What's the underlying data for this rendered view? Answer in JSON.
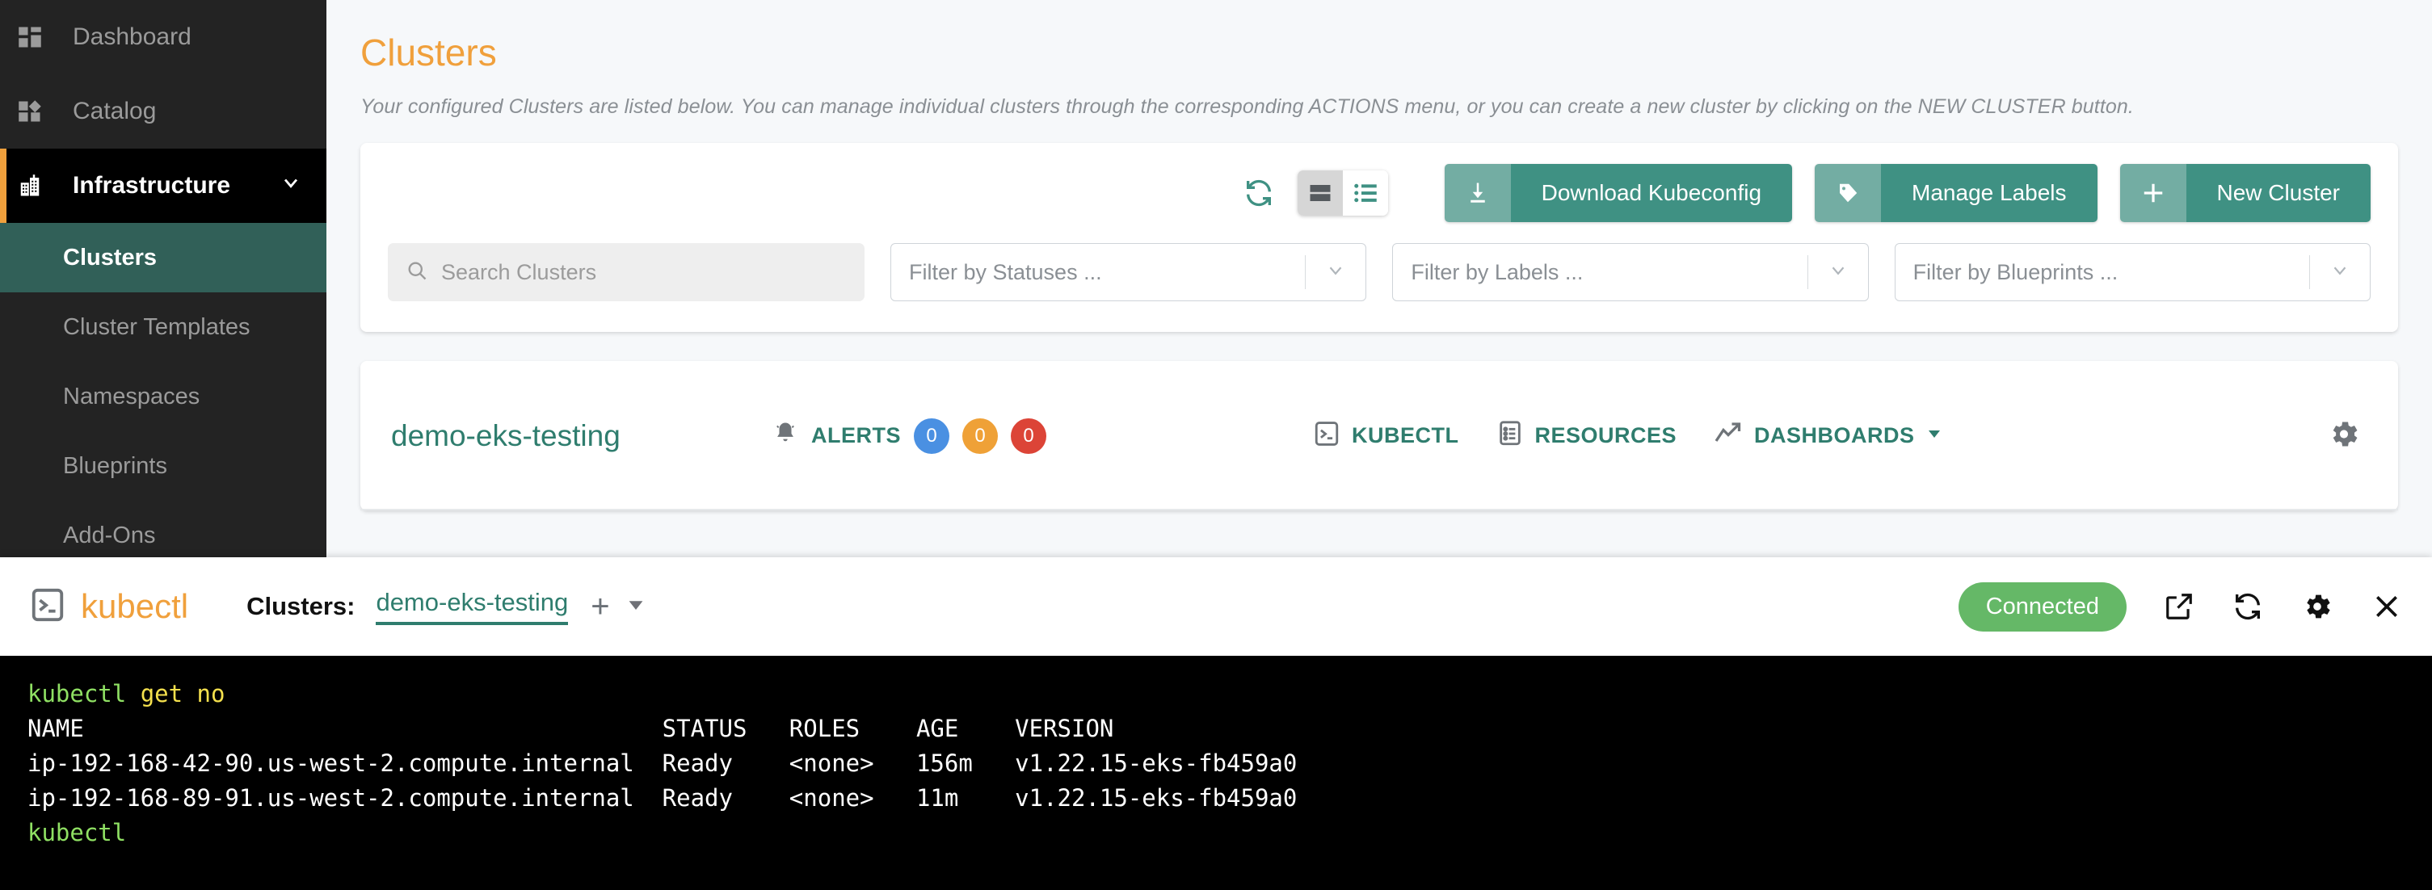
{
  "sidebar": {
    "top_items": [
      {
        "label": "Dashboard",
        "icon": "dashboard-grid-icon"
      },
      {
        "label": "Catalog",
        "icon": "catalog-icon"
      }
    ],
    "section": {
      "label": "Infrastructure",
      "icon": "building-icon",
      "chevron": "chevron-down-icon"
    },
    "sub_items": [
      {
        "label": "Clusters",
        "active": true
      },
      {
        "label": "Cluster Templates",
        "active": false
      },
      {
        "label": "Namespaces",
        "active": false
      },
      {
        "label": "Blueprints",
        "active": false
      },
      {
        "label": "Add-Ons",
        "active": false
      }
    ]
  },
  "main": {
    "title": "Clusters",
    "description": "Your configured Clusters are listed below. You can manage individual clusters through the corresponding ACTIONS menu, or you can create a new cluster by clicking on the NEW CLUSTER button.",
    "toolbar": {
      "refresh_icon": "refresh-icon",
      "view_card_icon": "card-view-icon",
      "view_list_icon": "list-view-icon",
      "buttons": [
        {
          "label": "Download Kubeconfig",
          "icon": "download-icon"
        },
        {
          "label": "Manage Labels",
          "icon": "tag-icon"
        },
        {
          "label": "New Cluster",
          "icon": "plus-icon"
        }
      ]
    },
    "filters": {
      "search_placeholder": "Search Clusters",
      "search_value": "",
      "selects": [
        {
          "placeholder": "Filter by Statuses ...",
          "value": ""
        },
        {
          "placeholder": "Filter by Labels ...",
          "value": ""
        },
        {
          "placeholder": "Filter by Blueprints ...",
          "value": ""
        }
      ]
    },
    "cluster_row": {
      "name": "demo-eks-testing",
      "alerts_label": "ALERTS",
      "alerts": [
        {
          "count": "0",
          "color": "#4a90e2"
        },
        {
          "count": "0",
          "color": "#efa137"
        },
        {
          "count": "0",
          "color": "#dc4437"
        }
      ],
      "actions": [
        {
          "label": "KUBECTL",
          "icon": "terminal-icon"
        },
        {
          "label": "RESOURCES",
          "icon": "resources-icon"
        },
        {
          "label": "DASHBOARDS",
          "icon": "trend-up-icon",
          "has_caret": true
        }
      ],
      "settings_icon": "gear-icon"
    }
  },
  "kubectl_panel": {
    "brand": "kubectl",
    "brand_icon": "terminal-icon",
    "clusters_label": "Clusters:",
    "active_cluster": "demo-eks-testing",
    "add_tab": "+",
    "tabs_caret": "caret-down-icon",
    "status": "Connected",
    "icons": [
      {
        "name": "open-external-icon"
      },
      {
        "name": "refresh-icon"
      },
      {
        "name": "gear-icon"
      },
      {
        "name": "close-icon"
      }
    ],
    "terminal": {
      "prompt_command": "kubectl",
      "prompt_args": "get no",
      "header": "NAME                                         STATUS   ROLES    AGE    VERSION",
      "rows": [
        "ip-192-168-42-90.us-west-2.compute.internal  Ready    <none>   156m   v1.22.15-eks-fb459a0",
        "ip-192-168-89-91.us-west-2.compute.internal  Ready    <none>   11m    v1.22.15-eks-fb459a0"
      ],
      "trailing_prompt": "kubectl"
    }
  },
  "colors": {
    "accent_orange": "#f0a03c",
    "teal": "#3f9183",
    "teal_dark": "#2f7d6e",
    "sidebar_bg": "#232323",
    "connected_green": "#65b867"
  }
}
